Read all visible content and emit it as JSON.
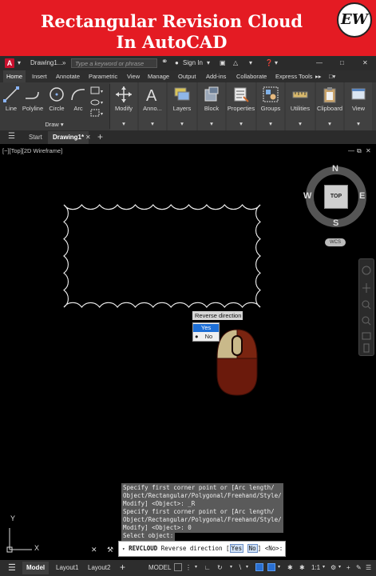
{
  "banner": {
    "line1": "Rectangular Revision Cloud",
    "line2": "In AutoCAD",
    "logo": "EW"
  },
  "titlebar": {
    "app_icon": "A",
    "doc_name": "Drawing1...",
    "search_placeholder": "Type a keyword or phrase",
    "sign_in": "Sign In",
    "help_icon": "help-icon"
  },
  "ribbon_tabs": [
    "Home",
    "Insert",
    "Annotate",
    "Parametric",
    "View",
    "Manage",
    "Output",
    "Add-ins",
    "Collaborate",
    "Express Tools"
  ],
  "ribbon": {
    "draw_tools": [
      "Line",
      "Polyline",
      "Circle",
      "Arc"
    ],
    "draw_panel_label": "Draw",
    "panels": [
      "Modify",
      "Anno...",
      "Layers",
      "Block",
      "Properties",
      "Groups",
      "Utilities",
      "Clipboard",
      "View"
    ]
  },
  "doc_tabs": {
    "start": "Start",
    "drawing": "Drawing1*"
  },
  "viewport": {
    "label": "[−][Top][2D Wireframe]",
    "viewcube": {
      "n": "N",
      "s": "S",
      "e": "E",
      "w": "W",
      "face": "TOP",
      "wcs": "WCS"
    },
    "ucs_y": "Y",
    "ucs_x": "X"
  },
  "context_menu": {
    "title": "Reverse direction",
    "options": [
      "Yes",
      "No"
    ],
    "selected": "Yes"
  },
  "command_history": [
    "Specify first corner point or [Arc length/\nObject/Rectangular/Polygonal/Freehand/Style/\nModify] <Object>: _R",
    "Specify first corner point or [Arc length/\nObject/Rectangular/Polygonal/Freehand/Style/\nModify] <Object>: 0",
    "Select object:"
  ],
  "command_line": {
    "command": "REVCLOUD",
    "prompt": "Reverse direction [",
    "opt_yes": "Yes",
    "opt_no": "No",
    "suffix": "] <No>:"
  },
  "status_bar": {
    "tabs": [
      "Model",
      "Layout1",
      "Layout2"
    ],
    "model_label": "MODEL",
    "scale": "1:1"
  },
  "colors": {
    "banner": "#e41b23",
    "mouse_body": "#6b1a0c",
    "mouse_button": "#c9b98a"
  }
}
